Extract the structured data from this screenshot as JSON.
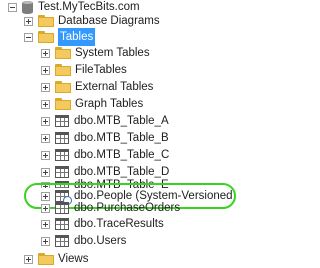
{
  "tree": {
    "server": "Test.MyTecBits.com",
    "database_diagrams": "Database Diagrams",
    "tables": "Tables",
    "system_tables": "System Tables",
    "file_tables": "FileTables",
    "external_tables": "External Tables",
    "graph_tables": "Graph Tables",
    "items": [
      "dbo.MTB_Table_A",
      "dbo.MTB_Table_B",
      "dbo.MTB_Table_C",
      "dbo.MTB_Table_D",
      "dbo.MTB_Table_E"
    ],
    "people": "dbo.People (System-Versioned)",
    "purchase_orders": "dbo.PurchaseOrders",
    "trace_results": "dbo.TraceResults",
    "users": "dbo.Users",
    "views": "Views"
  },
  "colors": {
    "selection": "#3399ff",
    "highlight": "#39d41f",
    "folder": "#f4c95d"
  }
}
